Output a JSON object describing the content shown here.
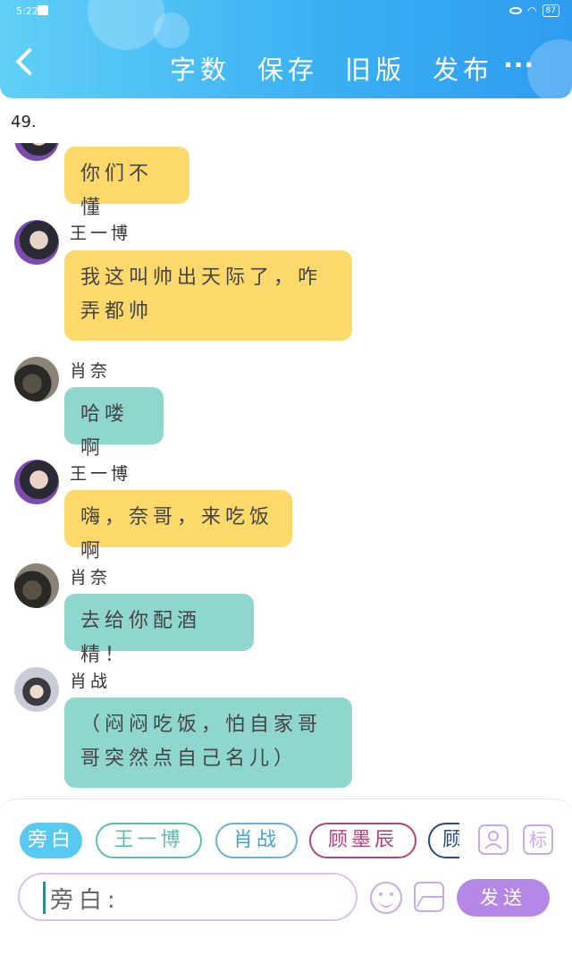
{
  "status_bar": {
    "time": "5:22",
    "battery": "87"
  },
  "header": {
    "nav": [
      "字数",
      "保存",
      "旧版",
      "发布"
    ],
    "more": "···"
  },
  "chapter_label": "49.",
  "messages": [
    {
      "speaker": "",
      "text": "你们不懂",
      "color": "yellow"
    },
    {
      "speaker": "王一博",
      "text": "我这叫帅出天际了，咋弄都帅",
      "color": "yellow"
    },
    {
      "speaker": "肖奈",
      "text": "哈喽啊",
      "color": "teal"
    },
    {
      "speaker": "王一博",
      "text": "嗨，奈哥，来吃饭啊",
      "color": "yellow"
    },
    {
      "speaker": "肖奈",
      "text": "去给你配酒精！",
      "color": "teal"
    },
    {
      "speaker": "肖战",
      "text": "（闷闷吃饭，怕自家哥哥突然点自己名儿）",
      "color": "teal"
    }
  ],
  "role_chips": [
    "旁白",
    "王一博",
    "肖战",
    "顾墨辰",
    "顾"
  ],
  "tools": {
    "add_role": "",
    "mark": "标"
  },
  "input": {
    "prefix": "旁白:"
  },
  "send_label": "发送",
  "colors": {
    "header": "#3aaef2",
    "yellow_bubble": "#fdd86b",
    "teal_bubble": "#8ed6ce",
    "send": "#b487e6"
  }
}
